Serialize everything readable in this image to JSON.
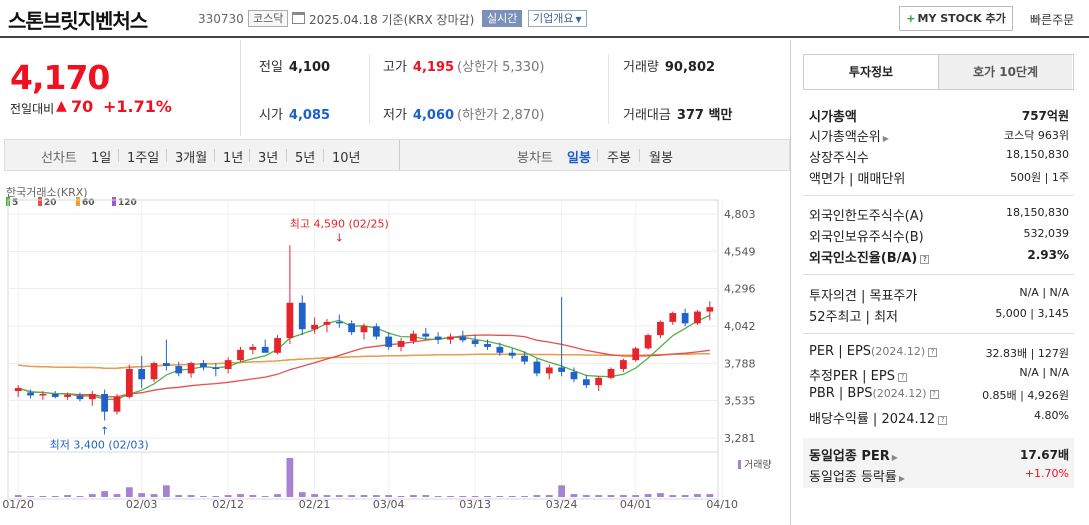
{
  "header": {
    "company_name": "스톤브릿지벤처스",
    "code": "330730",
    "market": "코스닥",
    "date": "2025.04.18 기준(KRX 장마감)",
    "realtime": "실시간",
    "company_info": "기업개요",
    "mystock_button": "MY STOCK 추가",
    "quick_order": "빠른주문"
  },
  "price": {
    "current": "4,170",
    "change_label": "전일대비",
    "change_arrow": "▲",
    "change": "70",
    "change_pct": "+1.71%"
  },
  "quotes": {
    "prev_close_label": "전일",
    "prev_close": "4,100",
    "open_label": "시가",
    "open": "4,085",
    "high_label": "고가",
    "high": "4,195",
    "upper_limit": "(상한가 5,330)",
    "low_label": "저가",
    "low": "4,060",
    "lower_limit": "(하한가 2,870)",
    "volume_label": "거래량",
    "volume": "90,802",
    "amount_label": "거래대금",
    "amount": "377 백만"
  },
  "chart_tabs": {
    "line_label": "선차트",
    "line_periods": [
      "1일",
      "1주일",
      "3개월",
      "1년",
      "3년",
      "5년",
      "10년"
    ],
    "candle_label": "봉차트",
    "candle_periods": [
      "일봉",
      "주봉",
      "월봉"
    ],
    "active_candle": "일봉"
  },
  "chart_data": {
    "type": "candlestick",
    "source": "한국거래소(KRX)",
    "moving_averages": [
      {
        "name": "5",
        "color": "#55b04a"
      },
      {
        "name": "20",
        "color": "#e64f4f"
      },
      {
        "name": "60",
        "color": "#f0a030"
      },
      {
        "name": "120",
        "color": "#9a5bd0"
      }
    ],
    "y_ticks": [
      "4,803",
      "4,549",
      "4,296",
      "4,042",
      "3,788",
      "3,535",
      "3,281"
    ],
    "ylim": [
      3281,
      4803
    ],
    "x_ticks": [
      {
        "label": "01/20",
        "i": 0
      },
      {
        "label": "02/03",
        "i": 10
      },
      {
        "label": "02/12",
        "i": 17
      },
      {
        "label": "02/21",
        "i": 24
      },
      {
        "label": "03/04",
        "i": 30
      },
      {
        "label": "03/13",
        "i": 37
      },
      {
        "label": "03/24",
        "i": 44
      },
      {
        "label": "04/01",
        "i": 50
      },
      {
        "label": "04/10",
        "i": 57
      }
    ],
    "max_annotation": {
      "label": "최고 4,590 (02/25)",
      "i": 26,
      "value": 4590
    },
    "min_annotation": {
      "label": "최저 3,400 (02/03)",
      "i": 7,
      "value": 3400
    },
    "volume_label": "거래량",
    "candles": [
      [
        3600,
        3640,
        3560,
        3620
      ],
      [
        3590,
        3610,
        3550,
        3570
      ],
      [
        3570,
        3600,
        3540,
        3580
      ],
      [
        3580,
        3600,
        3550,
        3560
      ],
      [
        3560,
        3590,
        3540,
        3575
      ],
      [
        3570,
        3590,
        3530,
        3545
      ],
      [
        3545,
        3600,
        3500,
        3580
      ],
      [
        3580,
        3610,
        3400,
        3460
      ],
      [
        3460,
        3580,
        3440,
        3560
      ],
      [
        3560,
        3780,
        3550,
        3750
      ],
      [
        3750,
        3840,
        3620,
        3680
      ],
      [
        3680,
        3800,
        3660,
        3790
      ],
      [
        3790,
        3950,
        3740,
        3770
      ],
      [
        3770,
        3800,
        3700,
        3720
      ],
      [
        3720,
        3800,
        3690,
        3790
      ],
      [
        3790,
        3810,
        3740,
        3760
      ],
      [
        3760,
        3790,
        3700,
        3750
      ],
      [
        3750,
        3830,
        3720,
        3810
      ],
      [
        3810,
        3900,
        3800,
        3880
      ],
      [
        3880,
        3920,
        3850,
        3900
      ],
      [
        3900,
        3950,
        3880,
        3860
      ],
      [
        3860,
        3980,
        3850,
        3960
      ],
      [
        3960,
        4590,
        3920,
        4200
      ],
      [
        4200,
        4250,
        3980,
        4020
      ],
      [
        4020,
        4100,
        3990,
        4050
      ],
      [
        4050,
        4090,
        4000,
        4070
      ],
      [
        4070,
        4120,
        4030,
        4060
      ],
      [
        4060,
        4080,
        3980,
        4000
      ],
      [
        4000,
        4060,
        3950,
        4040
      ],
      [
        4040,
        4060,
        3950,
        3970
      ],
      [
        3970,
        4000,
        3880,
        3900
      ],
      [
        3900,
        3960,
        3870,
        3940
      ],
      [
        3940,
        4010,
        3920,
        3990
      ],
      [
        3990,
        4030,
        3950,
        3970
      ],
      [
        3970,
        4000,
        3920,
        3950
      ],
      [
        3950,
        3990,
        3920,
        3970
      ],
      [
        3970,
        4010,
        3930,
        3945
      ],
      [
        3945,
        3980,
        3900,
        3920
      ],
      [
        3920,
        3950,
        3880,
        3900
      ],
      [
        3900,
        3930,
        3840,
        3860
      ],
      [
        3860,
        3890,
        3820,
        3840
      ],
      [
        3840,
        3870,
        3780,
        3800
      ],
      [
        3800,
        3820,
        3700,
        3720
      ],
      [
        3720,
        3780,
        3680,
        3760
      ],
      [
        3760,
        4240,
        3700,
        3730
      ],
      [
        3730,
        3760,
        3660,
        3680
      ],
      [
        3680,
        3710,
        3620,
        3640
      ],
      [
        3640,
        3700,
        3600,
        3690
      ],
      [
        3690,
        3760,
        3680,
        3750
      ],
      [
        3750,
        3820,
        3730,
        3810
      ],
      [
        3810,
        3900,
        3800,
        3890
      ],
      [
        3890,
        3990,
        3880,
        3980
      ],
      [
        3980,
        4080,
        3960,
        4070
      ],
      [
        4070,
        4140,
        4050,
        4130
      ],
      [
        4130,
        4160,
        4040,
        4060
      ],
      [
        4060,
        4150,
        4050,
        4140
      ],
      [
        4140,
        4210,
        4080,
        4170
      ]
    ],
    "volumes": [
      2,
      1,
      1,
      1,
      2,
      1,
      3,
      6,
      3,
      10,
      4,
      3,
      12,
      2,
      2,
      1,
      1,
      2,
      3,
      2,
      1,
      3,
      40,
      5,
      3,
      2,
      2,
      2,
      2,
      2,
      2,
      1,
      2,
      2,
      1,
      1,
      1,
      1,
      1,
      1,
      1,
      1,
      2,
      2,
      12,
      3,
      2,
      2,
      2,
      2,
      2,
      3,
      4,
      2,
      2,
      3,
      3
    ]
  },
  "side": {
    "tab_invest": "투자정보",
    "tab_quote": "호가 10단계",
    "market_cap_label": "시가총액",
    "market_cap": "757억원",
    "market_cap_rank_label": "시가총액순위",
    "market_cap_rank": "코스닥 963위",
    "shares_label": "상장주식수",
    "shares": "18,150,830",
    "par_label": "액면가 | 매매단위",
    "par": "500원 | 1주",
    "foreign_limit_label": "외국인한도주식수(A)",
    "foreign_limit": "18,150,830",
    "foreign_hold_label": "외국인보유주식수(B)",
    "foreign_hold": "532,039",
    "foreign_ratio_label": "외국인소진율(B/A)",
    "foreign_ratio": "2.93%",
    "opinion_label": "투자의견 | 목표주가",
    "opinion": "N/A | N/A",
    "wk52_label": "52주최고 | 최저",
    "wk52": "5,000 | 3,145",
    "per_label": "PER | EPS",
    "per_period": "(2024.12)",
    "per": "32.83배 | 127원",
    "est_per_label": "추정PER | EPS",
    "est_per": "N/A | N/A",
    "pbr_label": "PBR | BPS",
    "pbr_period": "(2024.12)",
    "pbr": "0.85배 | 4,926원",
    "dividend_label": "배당수익률 | 2024.12",
    "dividend": "4.80%",
    "industry_per_label": "동일업종 PER",
    "industry_per": "17.67배",
    "industry_chg_label": "동일업종 등락률",
    "industry_chg": "+1.70%"
  }
}
